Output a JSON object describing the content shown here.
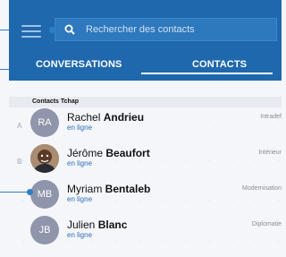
{
  "search": {
    "placeholder": "Rechercher des contacts"
  },
  "tabs": {
    "conversations": "CONVERSATIONS",
    "contacts": "CONTACTS"
  },
  "section": {
    "title": "Contacts Tchap"
  },
  "contacts": [
    {
      "letter": "A",
      "initials": "RA",
      "first": "Rachel",
      "last": "Andrieu",
      "status": "en ligne",
      "department": "Intradef",
      "avatar": "initials"
    },
    {
      "letter": "B",
      "initials": "",
      "first": "Jérôme",
      "last": "Beaufort",
      "status": "en ligne",
      "department": "Intérieur",
      "avatar": "photo"
    },
    {
      "letter": "",
      "initials": "MB",
      "first": "Myriam",
      "last": "Bentaleb",
      "status": "en ligne",
      "department": "Modernisation",
      "avatar": "initials"
    },
    {
      "letter": "",
      "initials": "JB",
      "first": "Julien",
      "last": "Blanc",
      "status": "en ligne",
      "department": "Diplomatie",
      "avatar": "initials"
    }
  ],
  "colors": {
    "header": "#1f68ae",
    "accent": "#2f7ec6",
    "avatar": "#8f95aa"
  }
}
